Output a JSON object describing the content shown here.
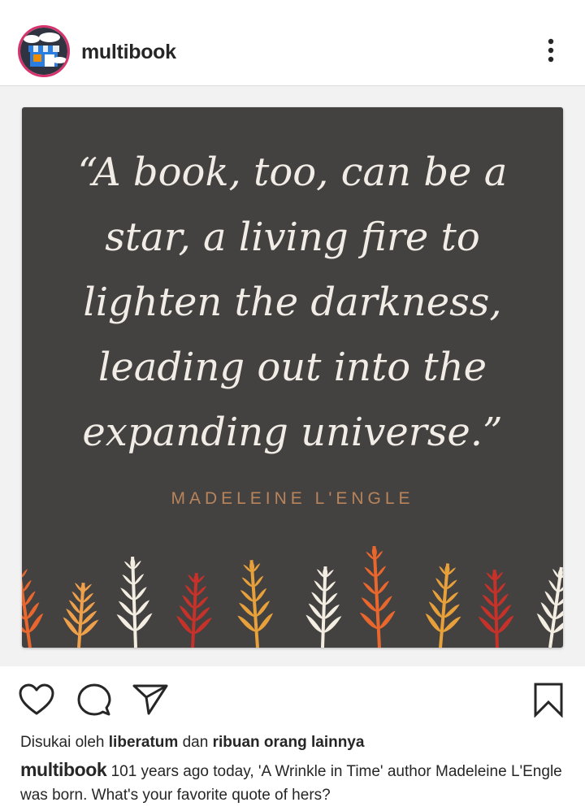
{
  "header": {
    "username": "multibook",
    "more_icon": "more-vertical-icon"
  },
  "post": {
    "quote_lines": [
      "“A book, too, can be a",
      "star, a living fire to",
      "lighten the darkness,",
      "leading out into the",
      "expanding universe.”"
    ],
    "quote_author": "MADELEINE L'ENGLE",
    "card_color": "#444141",
    "leaf_colors": [
      "#e9672d",
      "#eea04a",
      "#f3ede2",
      "#c6322a",
      "#e8a13a"
    ]
  },
  "actions": {
    "like_icon": "heart-icon",
    "comment_icon": "comment-icon",
    "share_icon": "share-icon",
    "save_icon": "bookmark-icon"
  },
  "likes": {
    "prefix": "Disukai oleh",
    "user": "liberatum",
    "middle": "dan",
    "others": "ribuan orang lainnya"
  },
  "caption": {
    "username": "multibook",
    "text": "101 years ago today, 'A Wrinkle in Time' author Madeleine L'Engle was born. What's your favorite quote of hers?"
  }
}
